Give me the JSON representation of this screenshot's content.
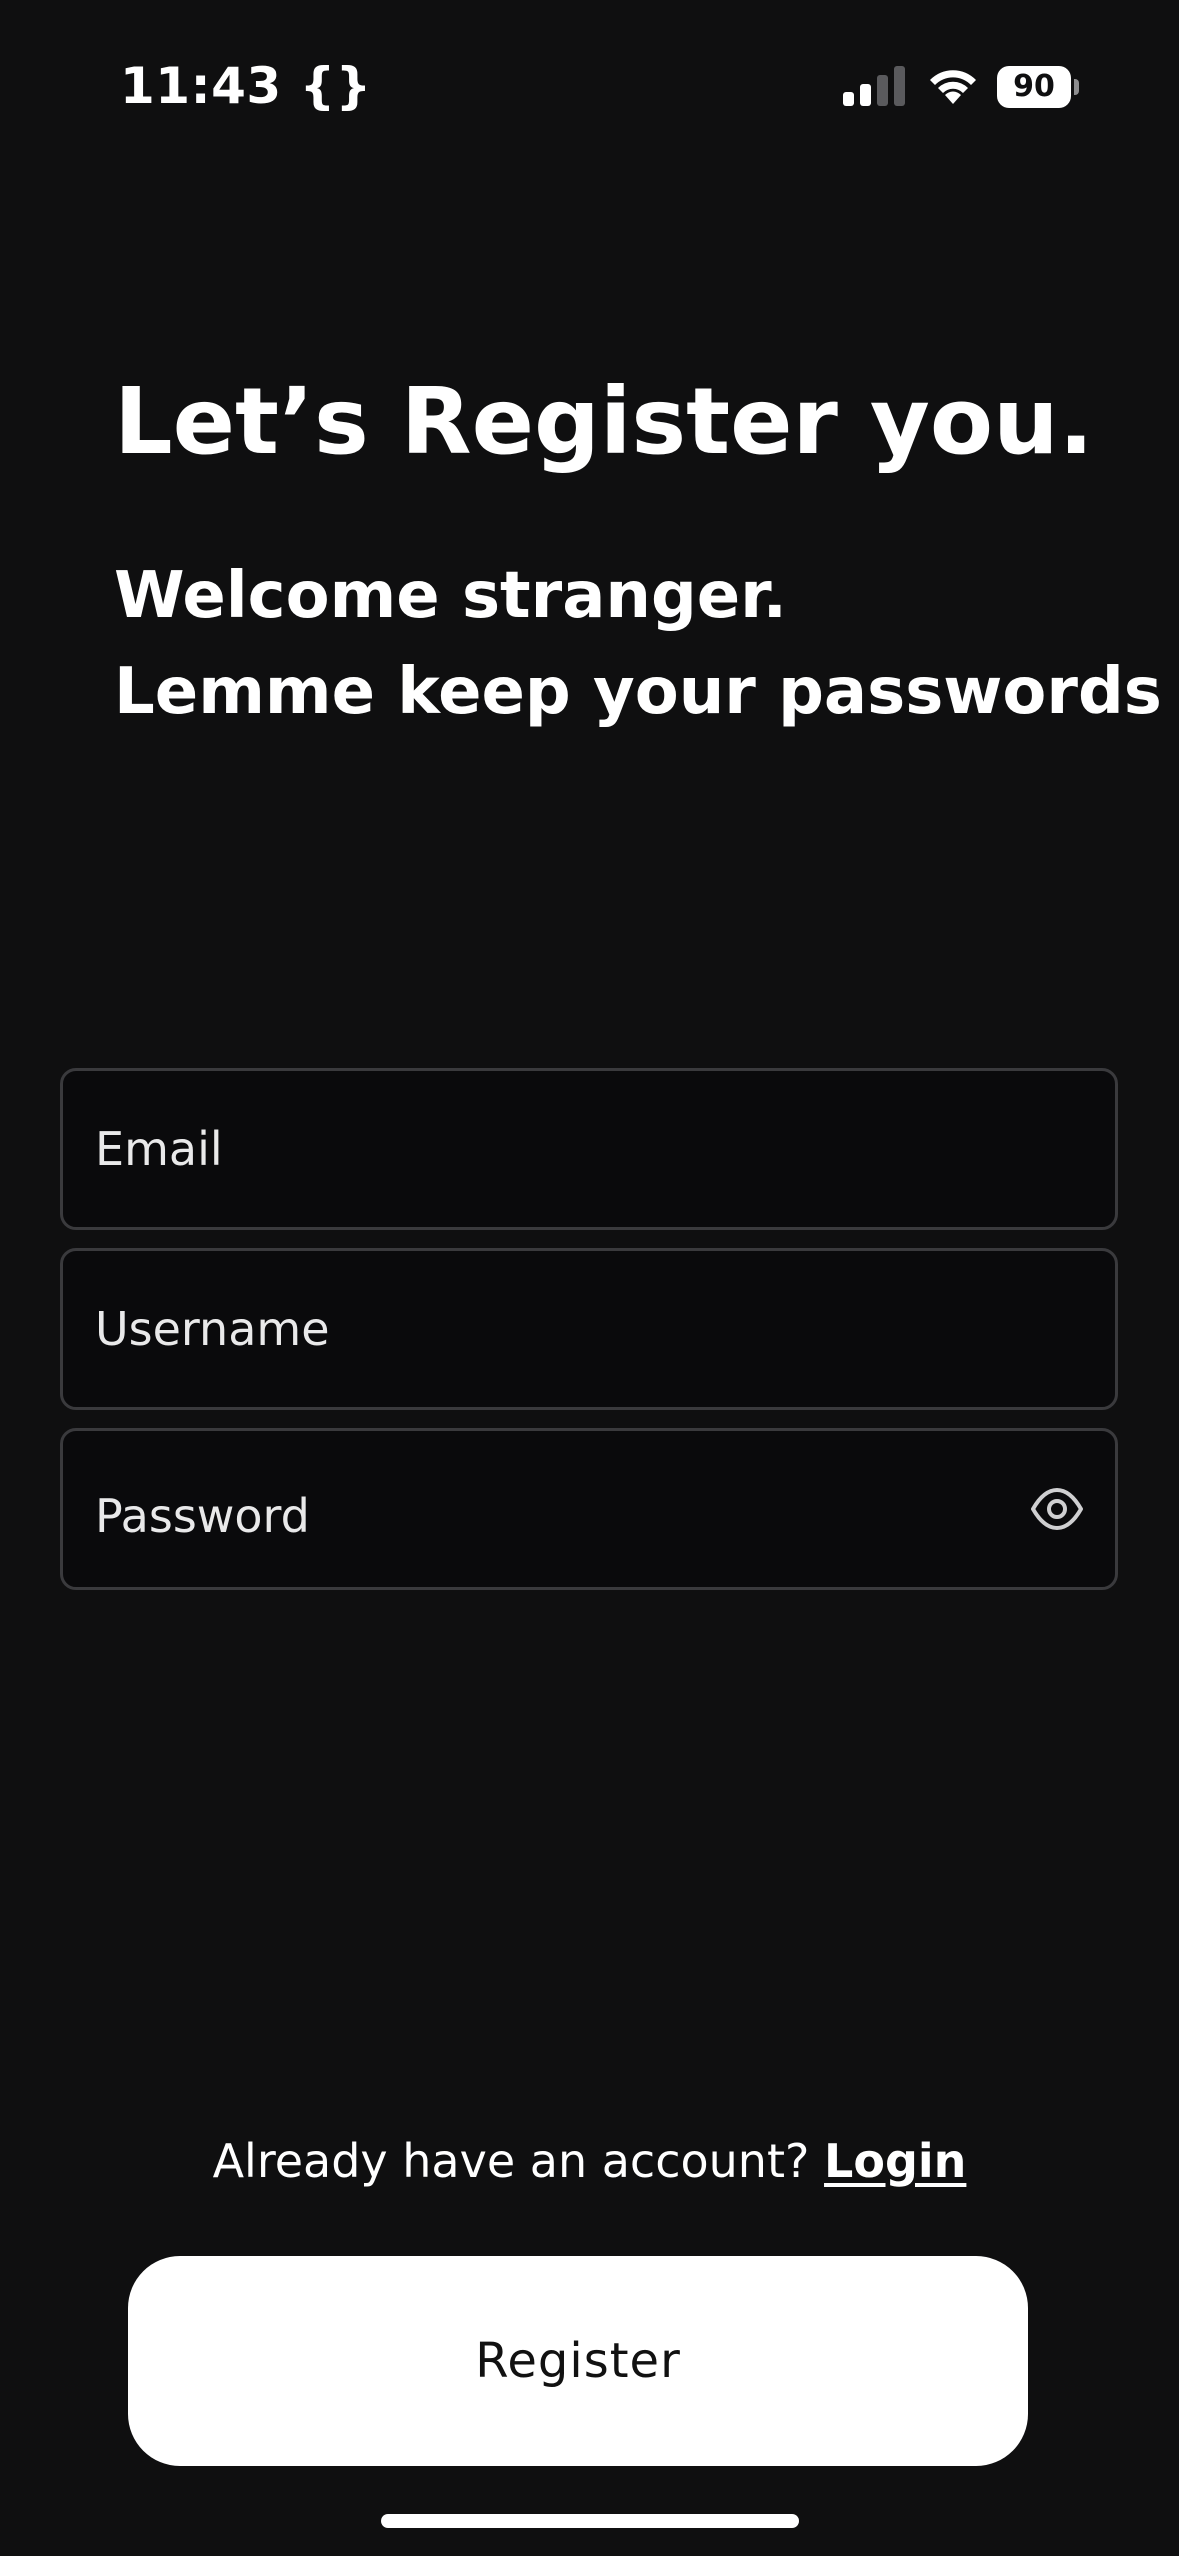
{
  "status_bar": {
    "time": "11:43 {}",
    "battery_level": "90",
    "icons": [
      "cellular-signal-icon",
      "wifi-icon",
      "battery-icon"
    ]
  },
  "header": {
    "title": "Let’s Register you.",
    "subtitle_line1": "Welcome stranger.",
    "subtitle_line2": "Lemme keep your passwords"
  },
  "form": {
    "email_placeholder": "Email",
    "username_placeholder": "Username",
    "password_placeholder": "Password",
    "password_toggle_icon": "eye-icon"
  },
  "footer": {
    "login_prompt": "Already have an account?",
    "login_link": "Login",
    "register_label": "Register"
  },
  "colors": {
    "background": "#0f0f10",
    "field_border": "#3a3a3d",
    "button_background": "#ffffff",
    "button_text": "#111111"
  }
}
